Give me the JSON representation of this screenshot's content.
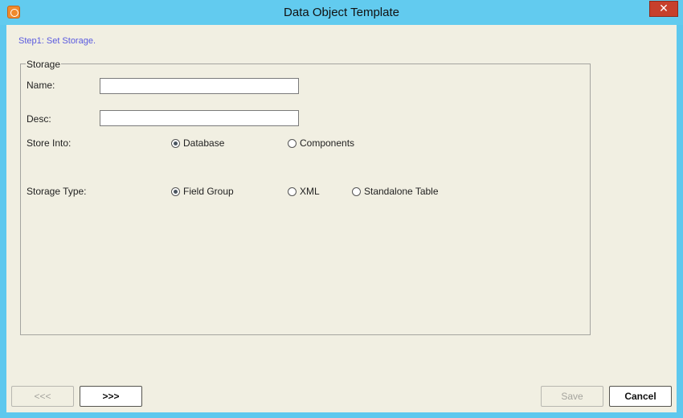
{
  "window": {
    "title": "Data Object Template",
    "close_glyph": "✕"
  },
  "step": "Step1: Set Storage.",
  "storage": {
    "legend": "Storage",
    "name_label": "Name:",
    "name_value": "",
    "desc_label": "Desc:",
    "desc_value": "",
    "store_into_label": "Store Into:",
    "store_into_options": [
      {
        "label": "Database",
        "selected": true
      },
      {
        "label": "Components",
        "selected": false
      }
    ],
    "storage_type_label": "Storage Type:",
    "storage_type_options": [
      {
        "label": "Field Group",
        "selected": true
      },
      {
        "label": "XML",
        "selected": false
      },
      {
        "label": "Standalone Table",
        "selected": false
      }
    ]
  },
  "buttons": {
    "back": {
      "label": "<<<",
      "enabled": false
    },
    "next": {
      "label": ">>>",
      "enabled": true
    },
    "save": {
      "label": "Save",
      "enabled": false
    },
    "cancel": {
      "label": "Cancel",
      "enabled": true
    }
  }
}
